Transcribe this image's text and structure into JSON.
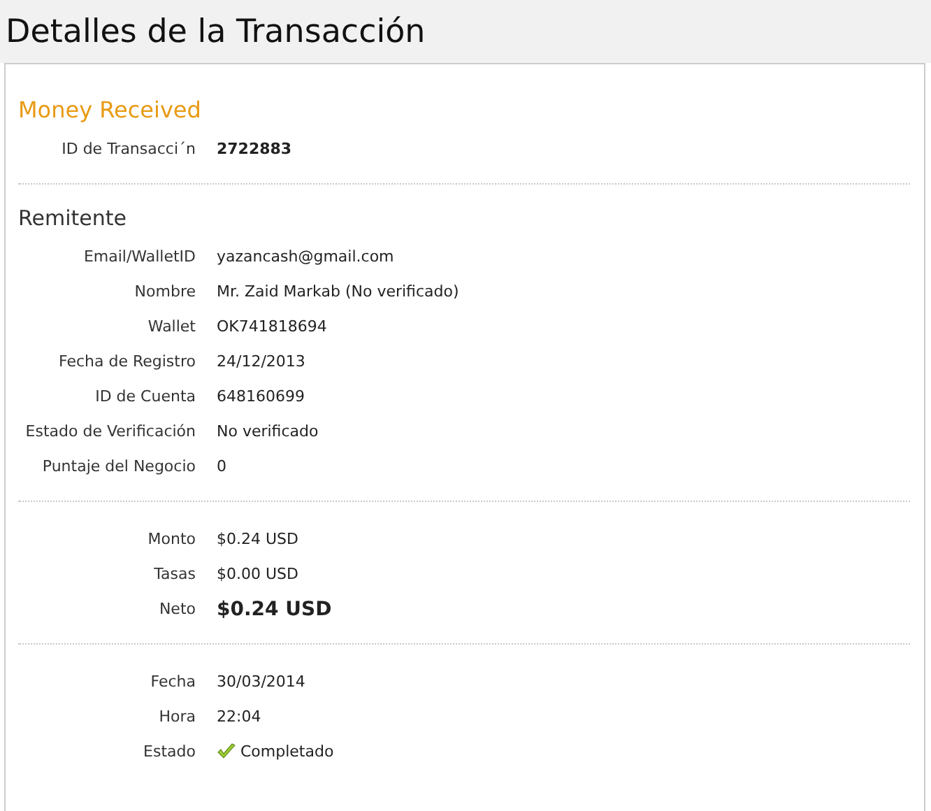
{
  "page_title": "Detalles de la Transacción",
  "sections": [
    {
      "title": "Money Received",
      "kind": "highlight",
      "rows": [
        {
          "label": "ID de Transacci´n",
          "value": "2722883",
          "kind": "bold"
        }
      ]
    },
    {
      "title": "Remitente",
      "kind": "plain",
      "rows": [
        {
          "label": "Email/WalletID",
          "value": "yazancash@gmail.com",
          "kind": "text"
        },
        {
          "label": "Nombre",
          "value": "Mr. Zaid Markab (No verificado)",
          "kind": "text"
        },
        {
          "label": "Wallet",
          "value": "OK741818694",
          "kind": "text"
        },
        {
          "label": "Fecha de Registro",
          "value": "24/12/2013",
          "kind": "text"
        },
        {
          "label": "ID de Cuenta",
          "value": "648160699",
          "kind": "text"
        },
        {
          "label": "Estado de Verificación",
          "value": "No verificado",
          "kind": "text"
        },
        {
          "label": "Puntaje del Negocio",
          "value": "0",
          "kind": "text"
        }
      ]
    },
    {
      "rows": [
        {
          "label": "Monto",
          "value": "$0.24 USD",
          "kind": "text"
        },
        {
          "label": "Tasas",
          "value": "$0.00 USD",
          "kind": "text"
        },
        {
          "label": "Neto",
          "value": "$0.24 USD",
          "kind": "large"
        }
      ]
    },
    {
      "rows": [
        {
          "label": "Fecha",
          "value": "30/03/2014",
          "kind": "text"
        },
        {
          "label": "Hora",
          "value": "22:04",
          "kind": "text"
        },
        {
          "label": "Estado",
          "value": "Completado",
          "kind": "status"
        }
      ]
    }
  ]
}
